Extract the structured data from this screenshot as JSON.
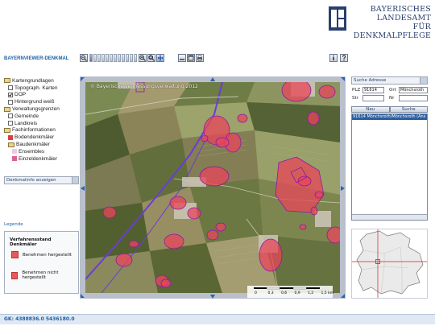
{
  "header": {
    "org_line1": "BAYERISCHES LANDESAMT",
    "org_line2": "FÜR DENKMALPFLEGE",
    "app_title": "BAYERNVIEWER-DENKMAL"
  },
  "toolbar": {
    "icons": [
      "zoom-out-icon",
      "zoom-in-icon",
      "zoom-box-icon",
      "pan-icon",
      "full-extent-icon",
      "window-icon",
      "print-icon",
      "info-icon",
      "help-icon"
    ],
    "zoom_steps": 12,
    "zoom_level_index": 0
  },
  "layers": {
    "items": [
      {
        "label": "Kartengrundlagen",
        "kind": "folder",
        "indent": 0
      },
      {
        "label": "Topograph. Karten",
        "kind": "check",
        "indent": 1,
        "checked": false
      },
      {
        "label": "DOP",
        "kind": "check",
        "indent": 1,
        "checked": true
      },
      {
        "label": "Hintergrund weiß",
        "kind": "check",
        "indent": 1,
        "checked": false
      },
      {
        "label": "Verwaltungsgrenzen",
        "kind": "folder",
        "indent": 0
      },
      {
        "label": "Gemeinde",
        "kind": "check",
        "indent": 1,
        "checked": false
      },
      {
        "label": "Landkreis",
        "kind": "check",
        "indent": 1,
        "checked": false
      },
      {
        "label": "Fachinformationen",
        "kind": "folder",
        "indent": 0
      },
      {
        "label": "Bodendenkmäler",
        "kind": "swatch",
        "indent": 1,
        "color": "#e03c3c"
      },
      {
        "label": "Baudenkmäler",
        "kind": "folder",
        "indent": 1
      },
      {
        "label": "Ensembles",
        "kind": "swatch",
        "indent": 2,
        "color": "#f3c7dd"
      },
      {
        "label": "Einzeldenkmäler",
        "kind": "swatch",
        "indent": 2,
        "color": "#e0609a"
      }
    ],
    "info_toggle_label": "Denkmalinfo anzeigen"
  },
  "legend": {
    "title": "Legende",
    "heading": "Verfahrensstand Denkmäler",
    "items": [
      {
        "label": "Benehmen hergestellt",
        "color": "#e85a5a"
      },
      {
        "label": "Benehmen nicht hergestellt",
        "color": "#e85a5a"
      }
    ]
  },
  "map": {
    "copyright": "© Bayerische Vermessungsverwaltung 2012",
    "scale_labels": [
      "0",
      "0,3",
      "0,6",
      "0,9",
      "1,2",
      "1,5 km"
    ],
    "colors": {
      "monument_fill": "#e8455a",
      "monument_stroke": "#8b1aa8",
      "road": "#6a3dd6"
    }
  },
  "search": {
    "mode": "Suche Adresse",
    "plz_label": "PLZ",
    "plz_value": "91614",
    "ort_label": "Ort",
    "ort_value": "Mönchsroth",
    "str_label": "Str",
    "str_value": "",
    "nr_label": "Nr",
    "nr_value": "",
    "new_button": "Neu",
    "search_button": "Suche",
    "result": "91614 Mönchsroth/Mönchsroth (Ans"
  },
  "footer": {
    "coords": "GK: 4388836.0 5436180.0"
  }
}
